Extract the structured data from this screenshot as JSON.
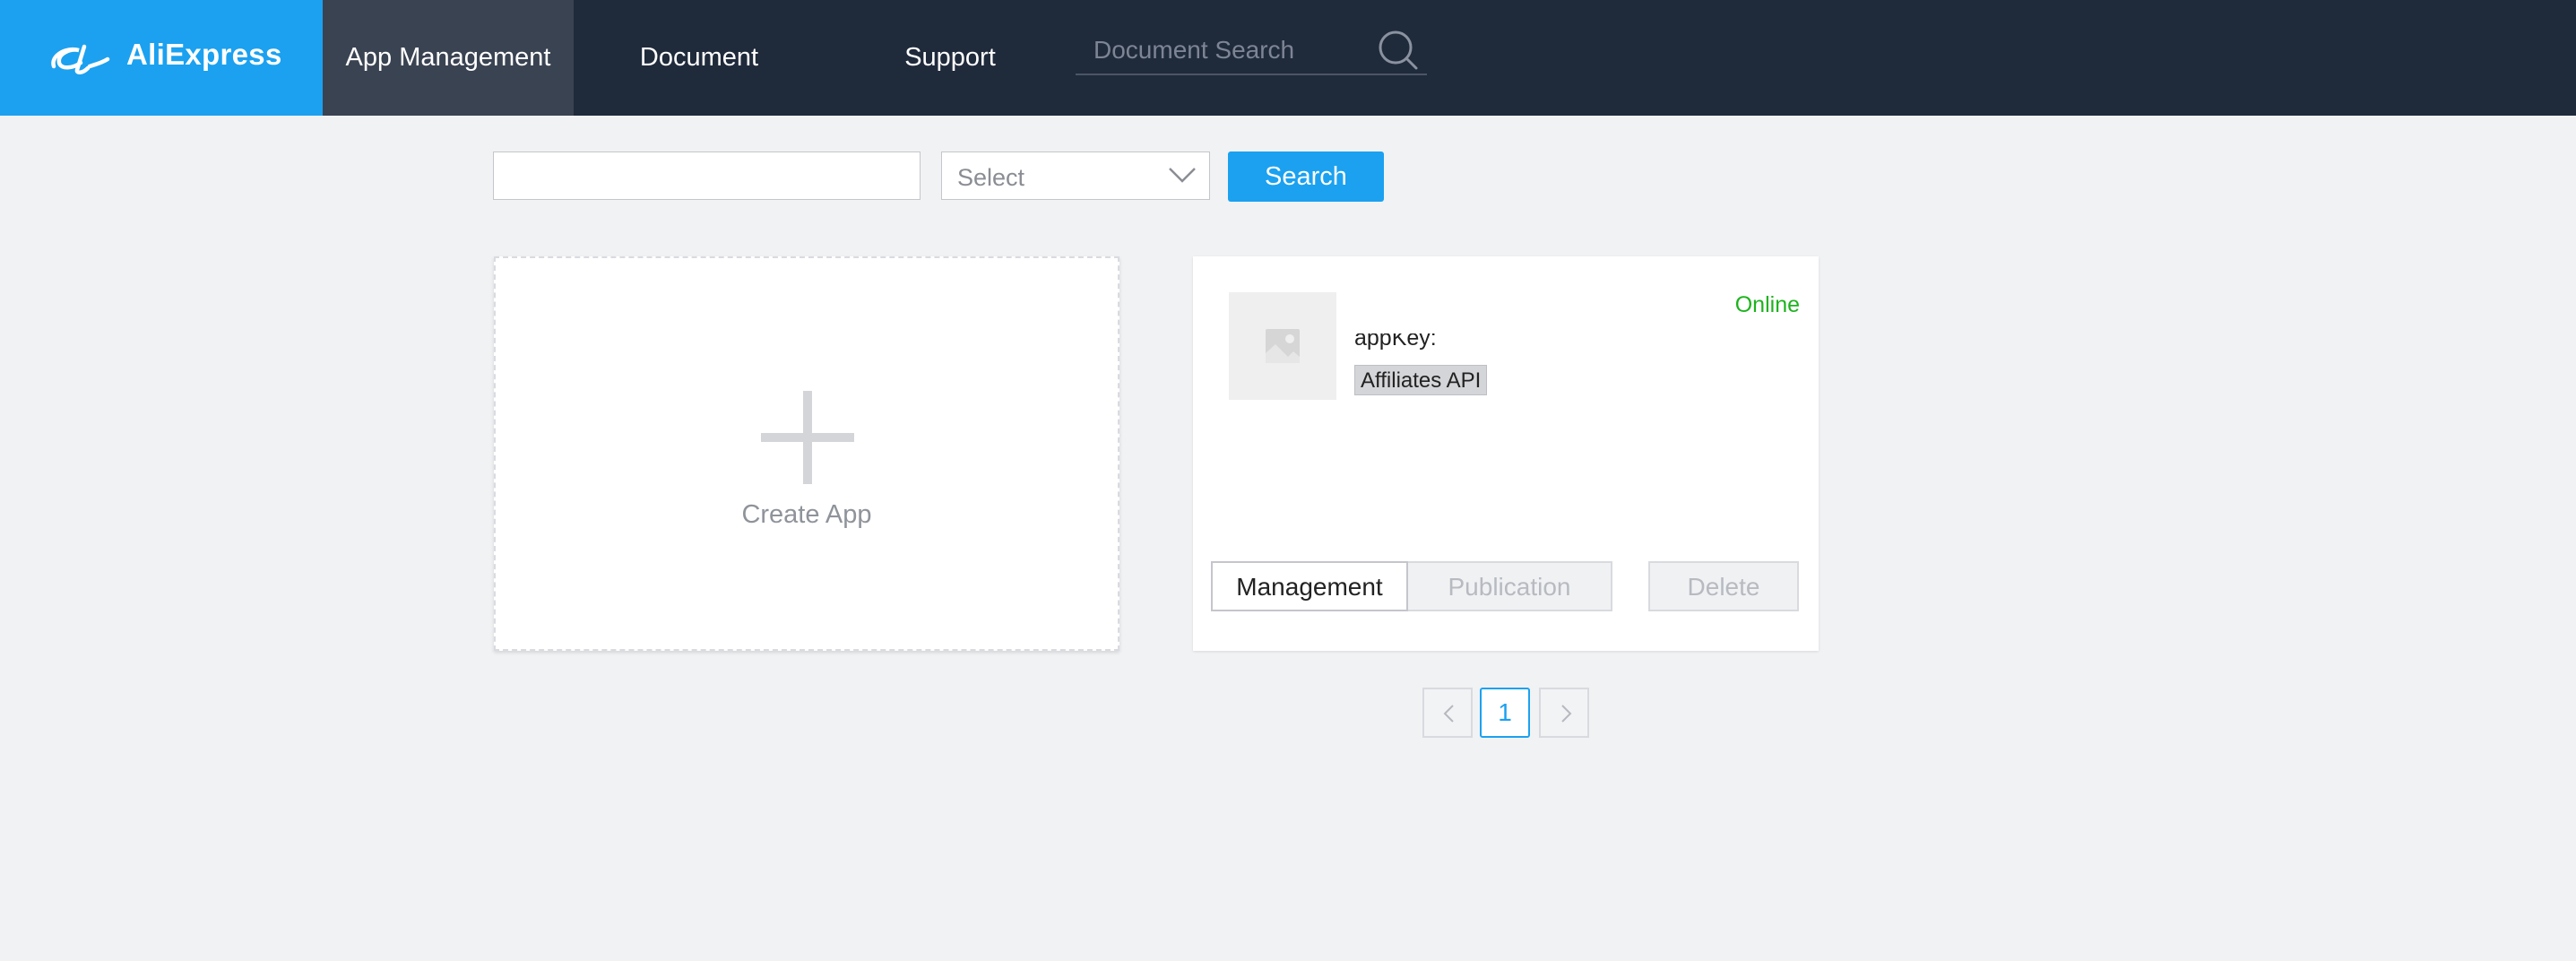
{
  "header": {
    "brand": "AliExpress",
    "nav": {
      "app_management": "App Management",
      "document": "Document",
      "support": "Support"
    },
    "doc_search_placeholder": "Document Search"
  },
  "filter": {
    "search_value": "",
    "select_label": "Select",
    "search_button": "Search"
  },
  "create_card": {
    "label": "Create App"
  },
  "app_card": {
    "status": "Online",
    "appkey_label": "appKey:",
    "appkey_value": "",
    "tag": "Affiliates API",
    "buttons": {
      "management": "Management",
      "publication": "Publication",
      "delete": "Delete"
    }
  },
  "pagination": {
    "current_page": "1"
  },
  "colors": {
    "topbar": "#1f2a3b",
    "brand": "#1ba1f0",
    "online": "#1db31d"
  }
}
